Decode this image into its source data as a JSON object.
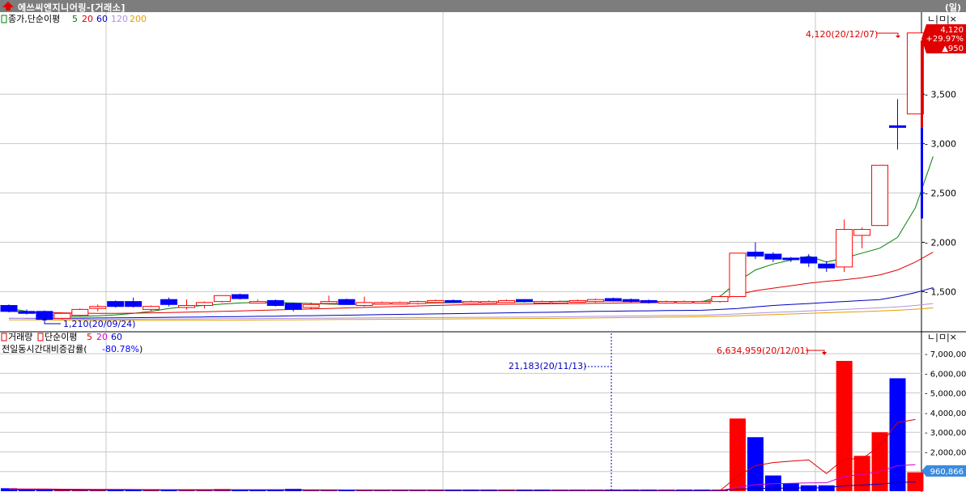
{
  "window": {
    "title": "에쓰씨엔지니어링-[거래소]",
    "period": "(일)"
  },
  "colors": {
    "up": "#ff0000",
    "down": "#0000ff",
    "ma5": "#008000",
    "ma20": "#e00000",
    "ma60": "#0000c0",
    "ma120": "#b090e0",
    "ma200": "#e0a000",
    "grid": "#c8c8c8"
  },
  "price_panel": {
    "legend_prefix": "종가,단순이평",
    "legend_periods": [
      "5",
      "20",
      "60",
      "120",
      "200"
    ],
    "max_label": "4,120(20/12/07)",
    "min_label": "1,210(20/09/24)",
    "current_price": "4,120",
    "change_pct": "+29.97%",
    "change_abs": "▲950",
    "ctrl_buttons": "ㄴ|ㅁ|×"
  },
  "volume_panel": {
    "legend_prefix": "거래량",
    "legend_sub": "단순이평",
    "legend_periods": [
      "5",
      "20",
      "60"
    ],
    "ratio_label": "전일동시간대비증감률(",
    "ratio_value": "-80.78%",
    "ratio_suffix": ")",
    "max_label": "6,634,959(20/12/01)",
    "marker_label": "21,183(20/11/13)",
    "current_volume": "960,866",
    "ctrl_buttons": "ㄴ|ㅁ|×"
  },
  "chart_data": [
    {
      "type": "candlestick",
      "title": "",
      "y_ticks": [
        1500,
        2000,
        2500,
        3000,
        3500
      ],
      "ylim": [
        1110,
        4290
      ],
      "series": [
        {
          "name": "5",
          "values": [
            1330,
            1300,
            1270,
            1250,
            1250,
            1255,
            1265,
            1280,
            1300,
            1330,
            1350,
            1360,
            1375,
            1385,
            1390,
            1390,
            1385,
            1380,
            1375,
            1370,
            1372,
            1375,
            1378,
            1382,
            1385,
            1388,
            1390,
            1392,
            1395,
            1397,
            1400,
            1402,
            1405,
            1405,
            1404,
            1402,
            1400,
            1400,
            1398,
            1398,
            1450,
            1600,
            1720,
            1780,
            1820,
            1860,
            1800,
            1840,
            1890,
            1940,
            2050,
            2350,
            2870
          ]
        },
        {
          "name": "20",
          "values": [
            1300,
            1295,
            1290,
            1285,
            1282,
            1280,
            1280,
            1282,
            1285,
            1288,
            1292,
            1296,
            1300,
            1305,
            1310,
            1315,
            1320,
            1325,
            1330,
            1335,
            1340,
            1345,
            1350,
            1355,
            1360,
            1365,
            1368,
            1370,
            1372,
            1374,
            1376,
            1378,
            1380,
            1382,
            1384,
            1386,
            1388,
            1390,
            1392,
            1395,
            1420,
            1470,
            1510,
            1535,
            1560,
            1585,
            1605,
            1620,
            1640,
            1670,
            1720,
            1800,
            1900
          ]
        },
        {
          "name": "60",
          "values": [
            1230,
            1230,
            1230,
            1232,
            1232,
            1234,
            1235,
            1236,
            1238,
            1240,
            1242,
            1244,
            1246,
            1248,
            1250,
            1252,
            1255,
            1257,
            1260,
            1262,
            1265,
            1267,
            1270,
            1272,
            1275,
            1277,
            1280,
            1282,
            1285,
            1288,
            1290,
            1293,
            1296,
            1300,
            1302,
            1304,
            1306,
            1308,
            1310,
            1312,
            1320,
            1330,
            1345,
            1360,
            1370,
            1380,
            1390,
            1400,
            1410,
            1420,
            1450,
            1490,
            1540
          ]
        },
        {
          "name": "120",
          "values": [
            1230,
            1228,
            1226,
            1224,
            1222,
            1220,
            1220,
            1221,
            1222,
            1223,
            1224,
            1225,
            1226,
            1227,
            1228,
            1229,
            1230,
            1231,
            1232,
            1233,
            1234,
            1235,
            1236,
            1237,
            1238,
            1239,
            1240,
            1241,
            1242,
            1243,
            1244,
            1246,
            1248,
            1250,
            1252,
            1254,
            1256,
            1258,
            1260,
            1262,
            1268,
            1275,
            1282,
            1290,
            1297,
            1305,
            1312,
            1320,
            1328,
            1336,
            1345,
            1360,
            1380
          ]
        },
        {
          "name": "200",
          "values": [
            1215,
            1214,
            1213,
            1212,
            1211,
            1210,
            1209,
            1209,
            1209,
            1209,
            1210,
            1210,
            1211,
            1212,
            1213,
            1214,
            1215,
            1216,
            1217,
            1218,
            1219,
            1220,
            1221,
            1222,
            1223,
            1224,
            1225,
            1226,
            1227,
            1228,
            1229,
            1230,
            1232,
            1234,
            1236,
            1238,
            1240,
            1242,
            1244,
            1246,
            1250,
            1256,
            1262,
            1268,
            1274,
            1280,
            1286,
            1292,
            1298,
            1304,
            1312,
            1322,
            1335
          ]
        }
      ],
      "candles": [
        {
          "o": 1360,
          "h": 1370,
          "l": 1290,
          "c": 1300
        },
        {
          "o": 1300,
          "h": 1320,
          "l": 1270,
          "c": 1280
        },
        {
          "o": 1300,
          "h": 1310,
          "l": 1210,
          "c": 1220
        },
        {
          "o": 1230,
          "h": 1290,
          "l": 1220,
          "c": 1280
        },
        {
          "o": 1260,
          "h": 1330,
          "l": 1250,
          "c": 1320
        },
        {
          "o": 1330,
          "h": 1370,
          "l": 1300,
          "c": 1350
        },
        {
          "o": 1400,
          "h": 1410,
          "l": 1340,
          "c": 1350
        },
        {
          "o": 1400,
          "h": 1440,
          "l": 1340,
          "c": 1350
        },
        {
          "o": 1320,
          "h": 1360,
          "l": 1300,
          "c": 1350
        },
        {
          "o": 1420,
          "h": 1440,
          "l": 1350,
          "c": 1370
        },
        {
          "o": 1340,
          "h": 1420,
          "l": 1320,
          "c": 1360
        },
        {
          "o": 1360,
          "h": 1400,
          "l": 1330,
          "c": 1390
        },
        {
          "o": 1400,
          "h": 1450,
          "l": 1390,
          "c": 1460
        },
        {
          "o": 1470,
          "h": 1480,
          "l": 1420,
          "c": 1430
        },
        {
          "o": 1400,
          "h": 1420,
          "l": 1380,
          "c": 1400
        },
        {
          "o": 1410,
          "h": 1420,
          "l": 1350,
          "c": 1360
        },
        {
          "o": 1380,
          "h": 1390,
          "l": 1300,
          "c": 1320
        },
        {
          "o": 1340,
          "h": 1390,
          "l": 1320,
          "c": 1370
        },
        {
          "o": 1380,
          "h": 1460,
          "l": 1370,
          "c": 1400
        },
        {
          "o": 1420,
          "h": 1430,
          "l": 1370,
          "c": 1370
        },
        {
          "o": 1360,
          "h": 1450,
          "l": 1350,
          "c": 1390
        },
        {
          "o": 1380,
          "h": 1400,
          "l": 1370,
          "c": 1390
        },
        {
          "o": 1380,
          "h": 1400,
          "l": 1370,
          "c": 1390
        },
        {
          "o": 1380,
          "h": 1410,
          "l": 1370,
          "c": 1400
        },
        {
          "o": 1390,
          "h": 1420,
          "l": 1380,
          "c": 1410
        },
        {
          "o": 1410,
          "h": 1420,
          "l": 1390,
          "c": 1400
        },
        {
          "o": 1400,
          "h": 1410,
          "l": 1390,
          "c": 1400
        },
        {
          "o": 1400,
          "h": 1410,
          "l": 1395,
          "c": 1400
        },
        {
          "o": 1390,
          "h": 1420,
          "l": 1390,
          "c": 1410
        },
        {
          "o": 1420,
          "h": 1420,
          "l": 1390,
          "c": 1400
        },
        {
          "o": 1400,
          "h": 1410,
          "l": 1390,
          "c": 1400
        },
        {
          "o": 1390,
          "h": 1410,
          "l": 1390,
          "c": 1400
        },
        {
          "o": 1400,
          "h": 1420,
          "l": 1390,
          "c": 1410
        },
        {
          "o": 1400,
          "h": 1430,
          "l": 1390,
          "c": 1420
        },
        {
          "o": 1430,
          "h": 1440,
          "l": 1400,
          "c": 1410
        },
        {
          "o": 1420,
          "h": 1430,
          "l": 1390,
          "c": 1400
        },
        {
          "o": 1410,
          "h": 1420,
          "l": 1380,
          "c": 1390
        },
        {
          "o": 1390,
          "h": 1410,
          "l": 1380,
          "c": 1400
        },
        {
          "o": 1400,
          "h": 1410,
          "l": 1390,
          "c": 1400
        },
        {
          "o": 1400,
          "h": 1410,
          "l": 1390,
          "c": 1400
        },
        {
          "o": 1400,
          "h": 1460,
          "l": 1390,
          "c": 1450
        },
        {
          "o": 1450,
          "h": 1890,
          "l": 1450,
          "c": 1890
        },
        {
          "o": 1900,
          "h": 2000,
          "l": 1830,
          "c": 1860
        },
        {
          "o": 1880,
          "h": 1900,
          "l": 1800,
          "c": 1830
        },
        {
          "o": 1840,
          "h": 1850,
          "l": 1800,
          "c": 1830
        },
        {
          "o": 1850,
          "h": 1880,
          "l": 1750,
          "c": 1790
        },
        {
          "o": 1780,
          "h": 1810,
          "l": 1700,
          "c": 1740
        },
        {
          "o": 1750,
          "h": 2230,
          "l": 1700,
          "c": 2130
        },
        {
          "o": 2070,
          "h": 2150,
          "l": 1940,
          "c": 2130
        },
        {
          "o": 2170,
          "h": 2780,
          "l": 2170,
          "c": 2780
        },
        {
          "o": 3180,
          "h": 3450,
          "l": 2940,
          "c": 3170
        },
        {
          "o": 3300,
          "h": 4120,
          "l": 3300,
          "c": 4120
        }
      ]
    },
    {
      "type": "bar",
      "title": "",
      "y_ticks": [
        1000000,
        2000000,
        3000000,
        4000000,
        5000000,
        6000000,
        7000000
      ],
      "y_tick_labels": [
        "1,000,000",
        "2,000,000",
        "3,000,000",
        "4,000,000",
        "5,000,000",
        "6,000,000",
        "7,000,000"
      ],
      "ylim": [
        0,
        7500000
      ],
      "values": [
        150000,
        120000,
        100000,
        80000,
        70000,
        60000,
        60000,
        80000,
        90000,
        60000,
        50000,
        70000,
        110000,
        70000,
        60000,
        90000,
        120000,
        60000,
        50000,
        40000,
        40000,
        40000,
        30000,
        30000,
        30000,
        30000,
        30000,
        20000,
        30000,
        30000,
        20000,
        20000,
        20000,
        21183,
        20000,
        20000,
        20000,
        20000,
        20000,
        20000,
        20000,
        3700000,
        2750000,
        800000,
        400000,
        300000,
        300000,
        6634959,
        1800000,
        3000000,
        5750000,
        960866
      ],
      "up": [
        false,
        false,
        false,
        true,
        true,
        true,
        false,
        false,
        true,
        false,
        true,
        true,
        true,
        false,
        false,
        false,
        false,
        true,
        true,
        false,
        true,
        true,
        true,
        true,
        true,
        false,
        false,
        false,
        true,
        false,
        false,
        true,
        true,
        true,
        false,
        false,
        false,
        true,
        false,
        false,
        true,
        true,
        false,
        false,
        false,
        false,
        false,
        true,
        true,
        true,
        false,
        true
      ],
      "series": [
        {
          "name": "5",
          "values": [
            120000,
            115000,
            110000,
            105000,
            100000,
            95000,
            90000,
            85000,
            80000,
            75000,
            70000,
            70000,
            75000,
            75000,
            72000,
            70000,
            68000,
            66000,
            64000,
            62000,
            60000,
            55000,
            50000,
            45000,
            40000,
            38000,
            36000,
            34000,
            32000,
            30000,
            28000,
            26000,
            24000,
            22000,
            22000,
            21000,
            21000,
            21000,
            20000,
            20000,
            20000,
            760000,
            1300000,
            1460000,
            1530000,
            1590000,
            900000,
            1650000,
            1650000,
            2300000,
            3500000,
            3650000
          ]
        },
        {
          "name": "20",
          "values": [
            90000,
            90000,
            88000,
            86000,
            84000,
            82000,
            80000,
            78000,
            76000,
            74000,
            72000,
            70000,
            70000,
            70000,
            68000,
            66000,
            64000,
            62000,
            60000,
            58000,
            56000,
            54000,
            52000,
            50000,
            48000,
            46000,
            44000,
            42000,
            40000,
            38000,
            36000,
            34000,
            32000,
            30000,
            30000,
            28000,
            28000,
            26000,
            26000,
            25000,
            25000,
            200000,
            330000,
            380000,
            400000,
            420000,
            430000,
            760000,
            850000,
            1000000,
            1300000,
            1350000
          ]
        },
        {
          "name": "60",
          "values": [
            60000,
            60000,
            60000,
            60000,
            59000,
            59000,
            58000,
            58000,
            57000,
            57000,
            56000,
            56000,
            55000,
            55000,
            54000,
            54000,
            53000,
            53000,
            52000,
            52000,
            51000,
            51000,
            50000,
            50000,
            49000,
            49000,
            48000,
            48000,
            47000,
            47000,
            46000,
            46000,
            45000,
            45000,
            44000,
            44000,
            43000,
            43000,
            42000,
            42000,
            41000,
            100000,
            140000,
            150000,
            160000,
            170000,
            175000,
            280000,
            310000,
            360000,
            450000,
            470000
          ]
        }
      ]
    }
  ]
}
